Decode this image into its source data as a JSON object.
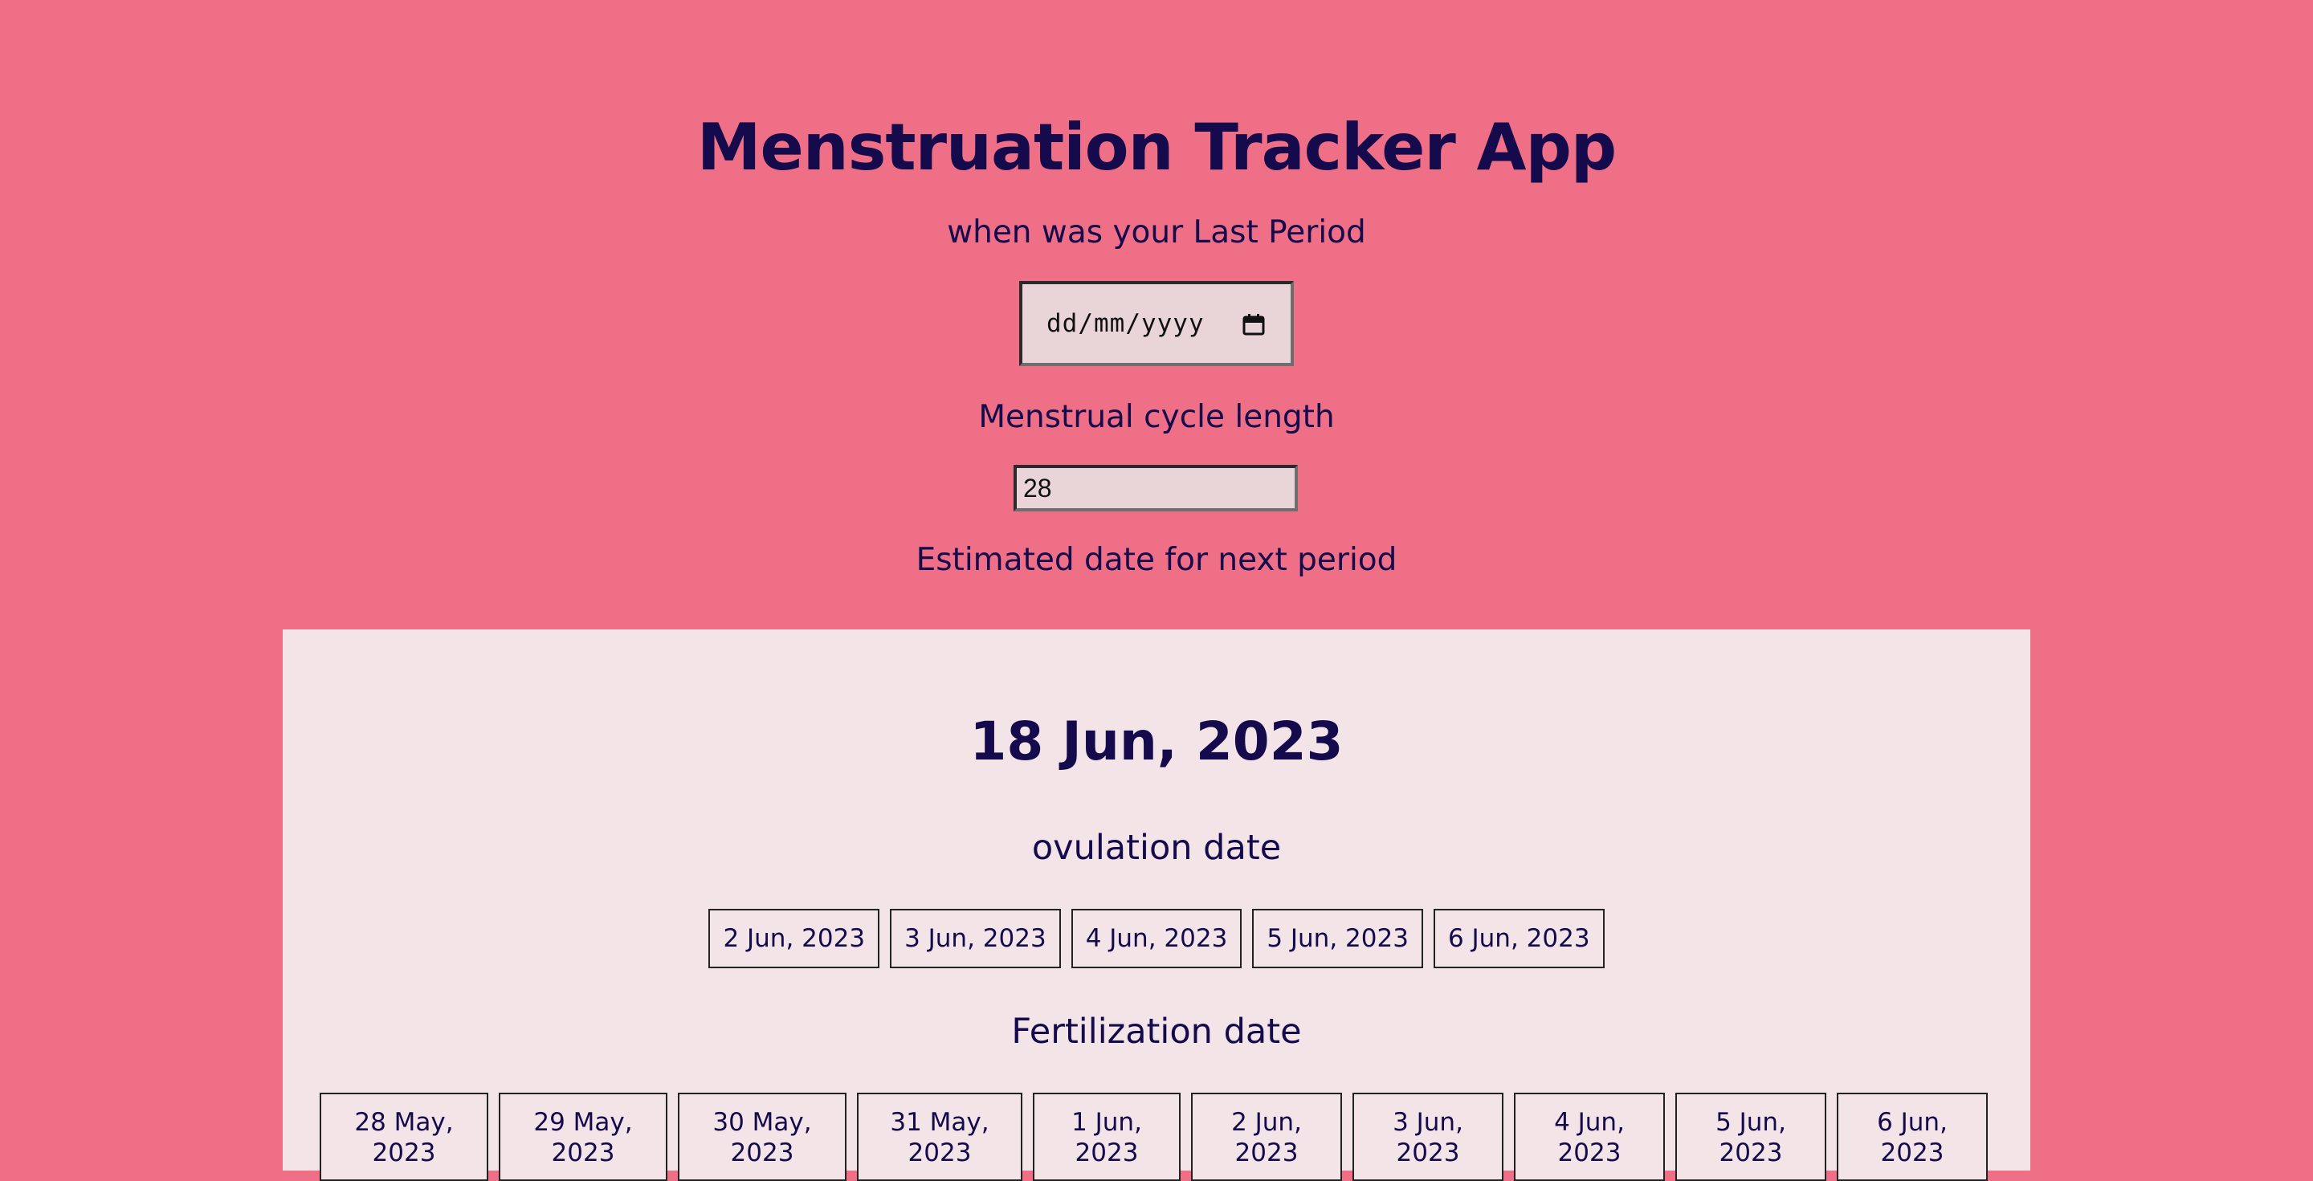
{
  "app": {
    "title": "Menstruation Tracker App"
  },
  "form": {
    "last_period_label": "when was your Last Period",
    "last_period_placeholder": "dd/mm/yyyy",
    "cycle_length_label": "Menstrual cycle length",
    "cycle_length_value": "28",
    "estimate_label": "Estimated date for next period"
  },
  "results": {
    "next_period_date": "18 Jun, 2023",
    "ovulation_heading": "ovulation date",
    "ovulation_dates": [
      "2 Jun, 2023",
      "3 Jun, 2023",
      "4 Jun, 2023",
      "5 Jun, 2023",
      "6 Jun, 2023"
    ],
    "fertilization_heading": "Fertilization date",
    "fertilization_dates": [
      {
        "day": "28 May,",
        "year": "2023"
      },
      {
        "day": "29 May,",
        "year": "2023"
      },
      {
        "day": "30 May,",
        "year": "2023"
      },
      {
        "day": "31 May,",
        "year": "2023"
      },
      {
        "day": "1 Jun,",
        "year": "2023"
      },
      {
        "day": "2 Jun,",
        "year": "2023"
      },
      {
        "day": "3 Jun,",
        "year": "2023"
      },
      {
        "day": "4 Jun,",
        "year": "2023"
      },
      {
        "day": "5 Jun,",
        "year": "2023"
      },
      {
        "day": "6 Jun,",
        "year": "2023"
      }
    ]
  },
  "colors": {
    "background": "#ef6f86",
    "panel": "#f3e4e7",
    "text": "#150a4c",
    "input_bg": "#e9d5d8"
  },
  "icons": {
    "date_picker": "calendar-icon"
  }
}
